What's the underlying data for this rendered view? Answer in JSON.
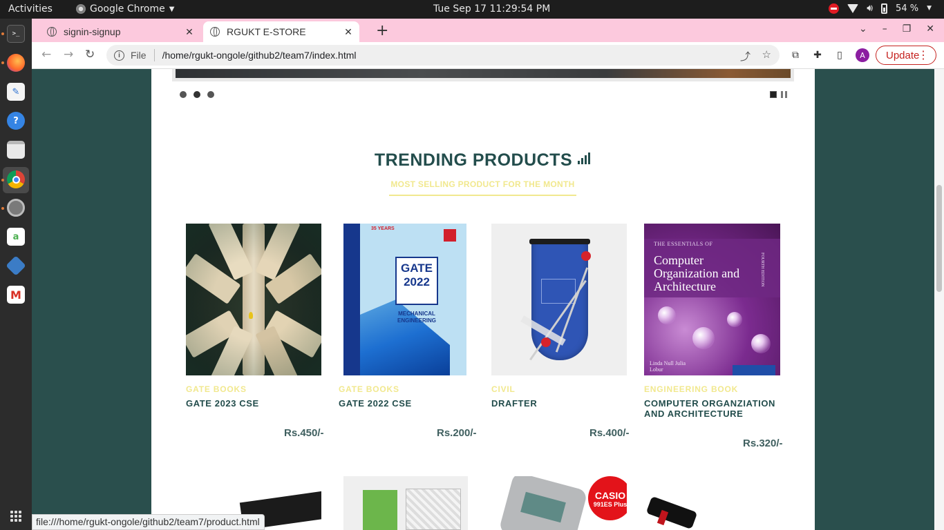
{
  "system": {
    "activities": "Activities",
    "app_menu": "Google Chrome",
    "clock": "Tue Sep 17  11:29:54 PM",
    "battery": "54 %"
  },
  "dock": {
    "items": [
      "terminal-icon",
      "firefox-icon",
      "text-editor-icon",
      "help-icon",
      "files-icon",
      "chrome-icon",
      "settings-icon",
      "software-icon",
      "virtualbox-icon",
      "gmail-icon",
      "apps-grid-icon"
    ]
  },
  "browser": {
    "tabs": [
      {
        "title": "signin-signup"
      },
      {
        "title": "RGUKT E-STORE"
      }
    ],
    "scheme": "File",
    "url": "/home/rgukt-ongole/github2/team7/index.html",
    "profile_initial": "A",
    "update_label": "Update",
    "status_url": "file:///home/rgukt-ongole/github2/team7/product.html"
  },
  "section": {
    "title": "TRENDING PRODUCTS",
    "subtitle": "MOST SELLING PRODUCT FOR THE MONTH"
  },
  "products": [
    {
      "category": "GATE BOOKS",
      "name": "GATE 2023 CSE",
      "price": "Rs.450/-"
    },
    {
      "category": "GATE BOOKS",
      "name": "GATE 2022 CSE",
      "price": "Rs.200/-"
    },
    {
      "category": "CIVIL",
      "name": "DRAFTER",
      "price": "Rs.400/-"
    },
    {
      "category": "ENGINEERING BOOK",
      "name": "COMPUTER ORGANZIATION AND ARCHITECTURE",
      "price": "Rs.320/-"
    }
  ],
  "book_covers": {
    "gate22_years": "35 YEARS",
    "gate22_title": "GATE",
    "gate22_year": "2022",
    "gate22_subject": "MECHANICAL ENGINEERING",
    "coa_header": "THE ESSENTIALS OF",
    "coa_title": "Computer Organization and Architecture",
    "coa_edition": "FOURTH EDITION",
    "coa_authors": "Linda Null  Julia Lobur",
    "calc_brand": "CASIO",
    "calc_model": "991ES Plus"
  },
  "colors": {
    "page_bg": "#2a4f4d",
    "title": "#234d4c",
    "accent_yellow": "#f1e88e",
    "tabstrip": "#fcc9dd"
  }
}
